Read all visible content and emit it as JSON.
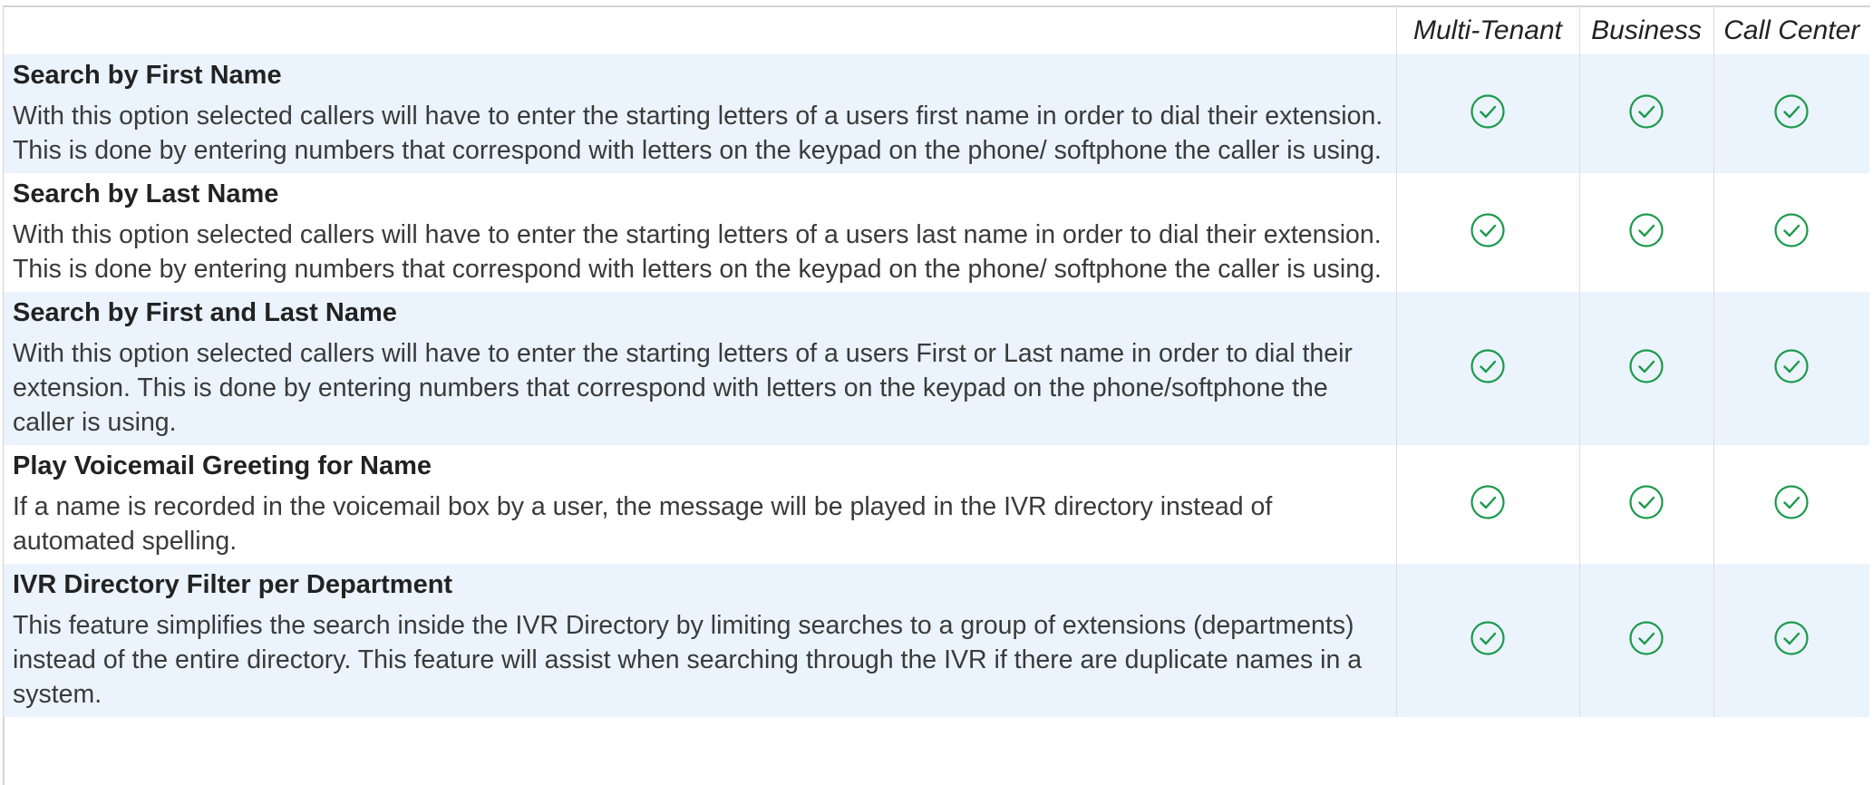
{
  "columns": {
    "multi_tenant": "Multi-Tenant",
    "business": "Business",
    "call_center": "Call Center"
  },
  "check_color": "#1a9a4a",
  "shaded_row_color": "#ebf3fd",
  "rows": [
    {
      "title": "Search by First Name",
      "description": "With this option selected callers will have to enter the starting letters of a users first name in order to dial their extension. This is done by entering numbers that correspond with letters on the keypad on the phone/ softphone the caller is using.",
      "multi_tenant": "check-icon",
      "business": "check-icon",
      "call_center": "check-icon"
    },
    {
      "title": "Search by Last Name",
      "description": "With this option selected callers will have to enter the starting letters of a users last name in order to dial their extension. This is done by entering numbers that correspond with letters on the keypad on the phone/ softphone the caller is using.",
      "multi_tenant": "check-icon",
      "business": "check-icon",
      "call_center": "check-icon"
    },
    {
      "title": "Search by First and Last Name",
      "description": "With this option selected callers will have to enter the starting letters of a users First or Last name in order to dial their extension. This is done by entering numbers that correspond with letters on the keypad on the phone/softphone the caller is using.",
      "multi_tenant": "check-icon",
      "business": "check-icon",
      "call_center": "check-icon"
    },
    {
      "title": "Play Voicemail Greeting for Name",
      "description": "If a name is recorded in the voicemail box by a user, the message will be played in the IVR directory instead of automated spelling.",
      "multi_tenant": "check-icon",
      "business": "check-icon",
      "call_center": "check-icon"
    },
    {
      "title": "IVR Directory Filter per Department",
      "description": "This feature simplifies the search inside the IVR Directory by limiting searches to a group of extensions (departments) instead of the entire directory. This feature will assist when searching through the IVR if there are duplicate names in a system.",
      "multi_tenant": "check-icon",
      "business": "check-icon",
      "call_center": "check-icon"
    }
  ]
}
